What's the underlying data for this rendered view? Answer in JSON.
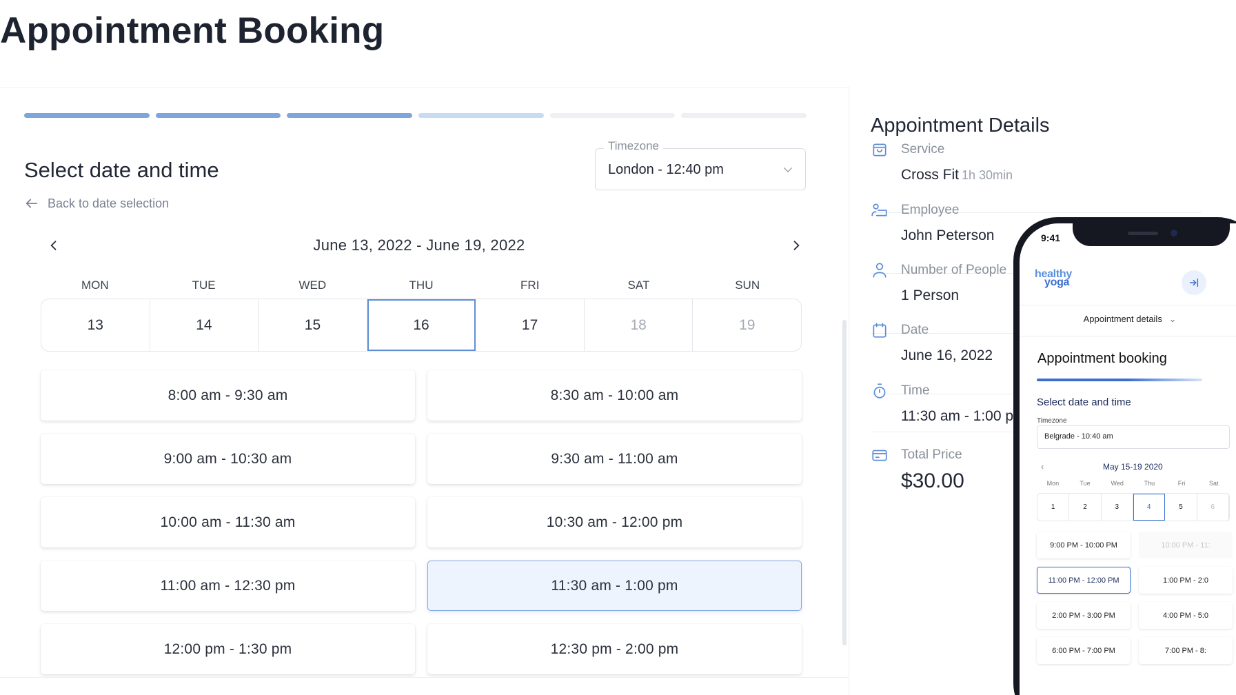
{
  "page": {
    "title": "Appointment Booking"
  },
  "booking": {
    "section_title": "Select date and time",
    "back_label": "Back to date selection",
    "timezone": {
      "label": "Timezone",
      "value": "London - 12:40 pm"
    },
    "week_label": "June 13, 2022 - June 19, 2022",
    "progress": {
      "done": 3,
      "partial": 1,
      "total": 6
    },
    "day_headers": [
      "MON",
      "TUE",
      "WED",
      "THU",
      "FRI",
      "SAT",
      "SUN"
    ],
    "days": [
      "13",
      "14",
      "15",
      "16",
      "17",
      "18",
      "19"
    ],
    "selected_day": "16",
    "slots": [
      "8:00 am  -  9:30 am",
      "8:30 am  -  10:00 am",
      "9:00 am  -  10:30 am",
      "9:30 am  -  11:00 am",
      "10:00 am  -  11:30 am",
      "10:30 am  -  12:00 pm",
      "11:00 am  -  12:30 pm",
      "11:30 am  -  1:00 pm",
      "12:00 pm  -  1:30 pm",
      "12:30 pm  -  2:00 pm"
    ]
  },
  "details": {
    "title": "Appointment Details",
    "service": {
      "label": "Service",
      "value": "Cross Fit",
      "duration": "1h 30min"
    },
    "employee": {
      "label": "Employee",
      "value": "John Peterson"
    },
    "people": {
      "label": "Number of People",
      "value": "1 Person"
    },
    "date": {
      "label": "Date",
      "value": "June 16, 2022"
    },
    "time": {
      "label": "Time",
      "value": "11:30 am  -  1:00 pm"
    },
    "price": {
      "label": "Total Price",
      "value": "$30.00"
    }
  },
  "phone": {
    "status_time": "9:41",
    "brand_top": "healthy",
    "brand_bottom": "yoga",
    "dropdown": "Appointment details",
    "heading": "Appointment booking",
    "subheading": "Select date and time",
    "tz_label": "Timezone",
    "tz_value": "Belgrade - 10:40 am",
    "week_label": "May 15-19 2020",
    "day_headers": [
      "Mon",
      "Tue",
      "Wed",
      "Thu",
      "Fri",
      "Sat"
    ],
    "days": [
      "1",
      "2",
      "3",
      "4",
      "5",
      "6"
    ],
    "slots": [
      "9:00 PM  -  10:00 PM",
      "10:00 PM  -  11:",
      "11:00 PM  -  12:00 PM",
      "1:00 PM  -  2:0",
      "2:00 PM  -  3:00 PM",
      "4:00 PM  -  5:0",
      "6:00 PM  -  7:00 PM",
      "7:00 PM  -  8:"
    ]
  },
  "colors": {
    "accent": "#7fa6dc",
    "accent_light": "#c9dbf3",
    "selected_bg": "#eef4fd",
    "brand": "#3a6fd0"
  }
}
